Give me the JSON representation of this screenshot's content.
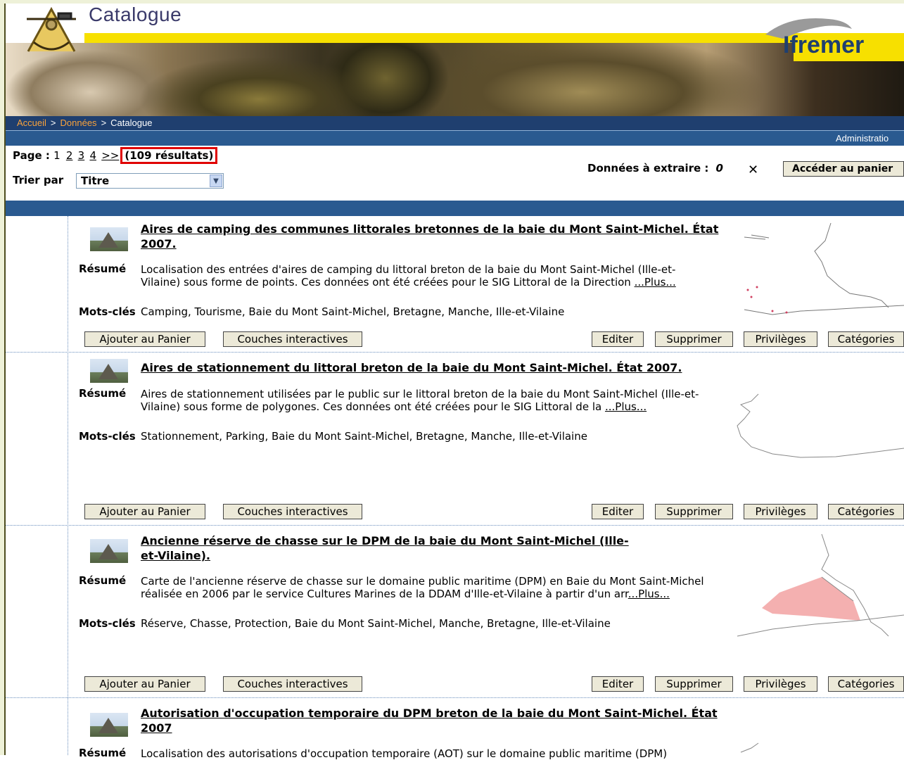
{
  "header": {
    "title": "Catalogue",
    "brand": "Ifremer"
  },
  "breadcrumb": {
    "home": "Accueil",
    "data": "Données",
    "current": "Catalogue",
    "separator": ">"
  },
  "admin_label": "Administratio",
  "pager": {
    "label": "Page :",
    "current": "1",
    "pages": [
      "2",
      "3",
      "4"
    ],
    "next": ">>",
    "results": "(109 résultats)"
  },
  "sort": {
    "label": "Trier par",
    "selected": "Titre"
  },
  "extract": {
    "label": "Données à extraire :",
    "count": "0"
  },
  "cart_button": "Accéder au panier",
  "labels": {
    "abstract": "Résumé",
    "keywords": "Mots-clés"
  },
  "buttons": {
    "add_cart": "Ajouter au Panier",
    "layers": "Couches interactives",
    "edit": "Editer",
    "delete": "Supprimer",
    "privileges": "Privilèges",
    "categories": "Catégories"
  },
  "records": [
    {
      "title": "Aires de camping des communes littorales bretonnes de la baie du Mont Saint-Michel. État 2007.",
      "abstract": "Localisation des entrées d'aires de camping du littoral breton de la baie du Mont Saint-Michel (Ille-et-Vilaine) sous forme de points. Ces données ont été créées pour le SIG Littoral de la Direction ",
      "more": "...Plus...",
      "keywords": "Camping, Tourisme, Baie du Mont Saint-Michel, Bretagne, Manche, Ille-et-Vilaine"
    },
    {
      "title": "Aires de stationnement du littoral breton de la baie du Mont Saint-Michel. État 2007.",
      "abstract": "Aires de stationnement utilisées par le public sur le littoral breton de la baie du Mont Saint-Michel (Ille-et-Vilaine) sous forme de polygones. Ces données ont été créées pour le SIG Littoral de la ",
      "more": "...Plus...",
      "keywords": "Stationnement, Parking, Baie du Mont Saint-Michel, Bretagne, Manche, Ille-et-Vilaine"
    },
    {
      "title": "Ancienne réserve de chasse sur le DPM de la baie du Mont Saint-Michel (Ille-et-Vilaine).",
      "abstract": "Carte de l'ancienne réserve de chasse sur le domaine public maritime (DPM) en Baie du Mont Saint-Michel réalisée en 2006 par le service Cultures Marines de la DDAM d'Ille-et-Vilaine à partir d'un arr",
      "more": "...Plus...",
      "keywords": "Réserve, Chasse, Protection, Baie du Mont Saint-Michel, Manche, Bretagne, Ille-et-Vilaine"
    },
    {
      "title": "Autorisation d'occupation temporaire du DPM breton de la baie du Mont Saint-Michel. État 2007",
      "abstract": "Localisation des autorisations d'occupation temporaire (AOT) sur le domaine public maritime (DPM)"
    }
  ]
}
